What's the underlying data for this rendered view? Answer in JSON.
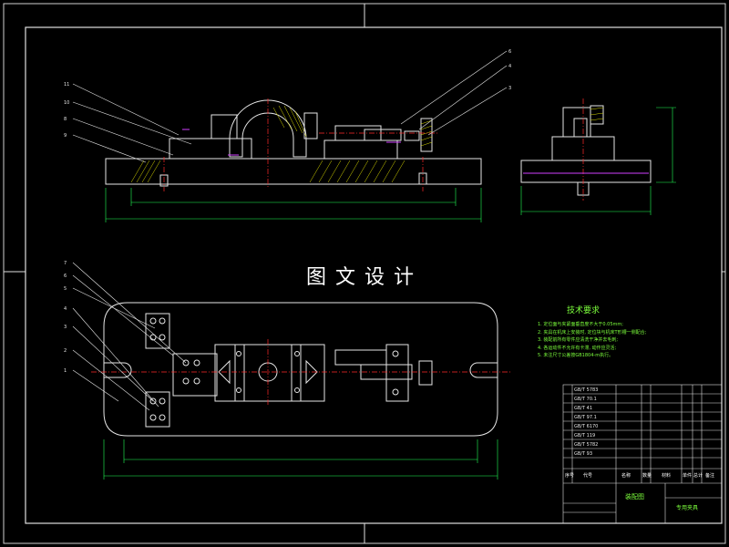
{
  "drawing": {
    "title": "图文设计",
    "accent": "#ffffff",
    "linework": "#e6e6e6",
    "dim_color": "#22ff55",
    "center_color": "#ff2a2a",
    "hatch_color": "#d9d900",
    "text_green": "#7cff3c",
    "top_view_callouts": [
      "11",
      "10",
      "8",
      "9"
    ],
    "right_top_callouts": [
      "6",
      "4",
      "3"
    ],
    "plan_callouts": [
      "7",
      "6",
      "5",
      "4",
      "3",
      "2",
      "1"
    ]
  },
  "tech": {
    "title": "技术要求",
    "items": [
      "1. 定位面与夹紧面垂直度不大于0.05mm;",
      "2. 夹具在机床上安装时, 定位块与机床T形槽一侧配合;",
      "3. 装配前所有零件应清洗干净并去毛刺;",
      "4. 各运动件不允许有卡滞, 动作应灵活;",
      "5. 未注尺寸公差按GB1804-m执行。"
    ]
  },
  "title_block": {
    "drawing_name": "装配图",
    "part_name": "专用夹具",
    "rows": [
      "GB/T 5783",
      "GB/T 70.1",
      "GB/T 41",
      "GB/T 97.1",
      "GB/T 6170",
      "GB/T 119",
      "GB/T 5782",
      "GB/T 93"
    ],
    "header": [
      "序号",
      "代号",
      "名称",
      "数量",
      "材料",
      "单件",
      "总计",
      "备注"
    ]
  }
}
